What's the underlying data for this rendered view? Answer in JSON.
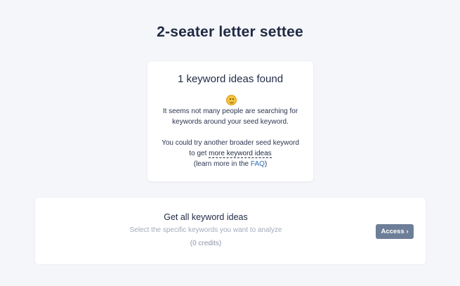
{
  "page": {
    "title": "2-seater letter settee"
  },
  "results": {
    "heading": "1 keyword ideas found",
    "emoji_icon": "slightly-frowning-face-icon",
    "line1": "It seems not many people are searching for",
    "line2": "keywords around your seed keyword.",
    "line3": "You could try another broader seed keyword",
    "line4_prefix": "to get ",
    "line4_link": "more keyword ideas",
    "line5_prefix": "(learn more in the ",
    "faq_link": "FAQ",
    "line5_suffix": ")"
  },
  "access": {
    "heading": "Get all keyword ideas",
    "subtitle": "Select the specific keywords you want to analyze",
    "credits": "(0 credits)",
    "button_label": "Access ›"
  },
  "colors": {
    "background": "#f5f6f9",
    "button": "#6d7e98",
    "link": "#2f6db5"
  }
}
